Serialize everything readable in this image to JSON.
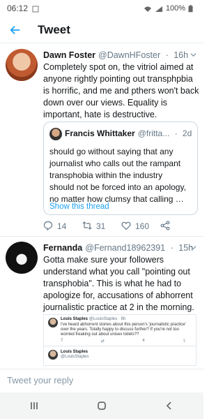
{
  "status_bar": {
    "time": "06:12",
    "battery": "100%"
  },
  "header": {
    "title": "Tweet"
  },
  "main_tweet": {
    "name": "Dawn Foster",
    "handle": "@DawnHFoster",
    "age": "16h",
    "lines": [
      "Completely spot on, the vitriol aimed at",
      "anyone rightly pointing out transphpbia",
      "is horrific, and me and pthers won't back",
      "down over our views. Equality is",
      "important, hate is destructive."
    ],
    "quote": {
      "name": "Francis Whittaker",
      "handle": "@fritta...",
      "age": "2d",
      "lines": [
        "should go without saying that any",
        "journalist who calls out the rampant",
        "transphobia within the industry",
        "should not be forced into an apology,",
        "no matter how clumsy that calling …"
      ],
      "show_thread": "Show this thread"
    },
    "replies": "14",
    "retweets": "31",
    "likes": "160"
  },
  "reply_tweet": {
    "name": "Fernanda",
    "handle": "@Fernand18962391",
    "age": "15h",
    "lines": [
      "Gotta make sure your followers",
      "understand what you call \"pointing out",
      "transphobia\". This is what he had to",
      "apologize for, accusations of abhorrent",
      "journalistic practice at 2 in the morning."
    ],
    "embed": {
      "name": "Louis Staples",
      "handle": "@LouisStaples · 8h",
      "text": "I've heard abhorrent stories about this person's 'journalistic practice' over the years. Totally happy to discuss further? If you're not too worried freaking out about unisex toilets??",
      "replies": "7",
      "likes": "4",
      "name2": "Louis Staples",
      "handle2": "@LouisStaples"
    }
  },
  "reply_bar": {
    "placeholder": "Tweet your reply"
  },
  "colors": {
    "accent": "#1da1f2",
    "text": "#14171a",
    "muted": "#657786"
  },
  "icons": [
    "back-arrow-icon",
    "caret-down-icon",
    "reply-icon",
    "retweet-icon",
    "like-icon",
    "share-icon",
    "recents-icon",
    "home-icon",
    "back-nav-icon"
  ]
}
